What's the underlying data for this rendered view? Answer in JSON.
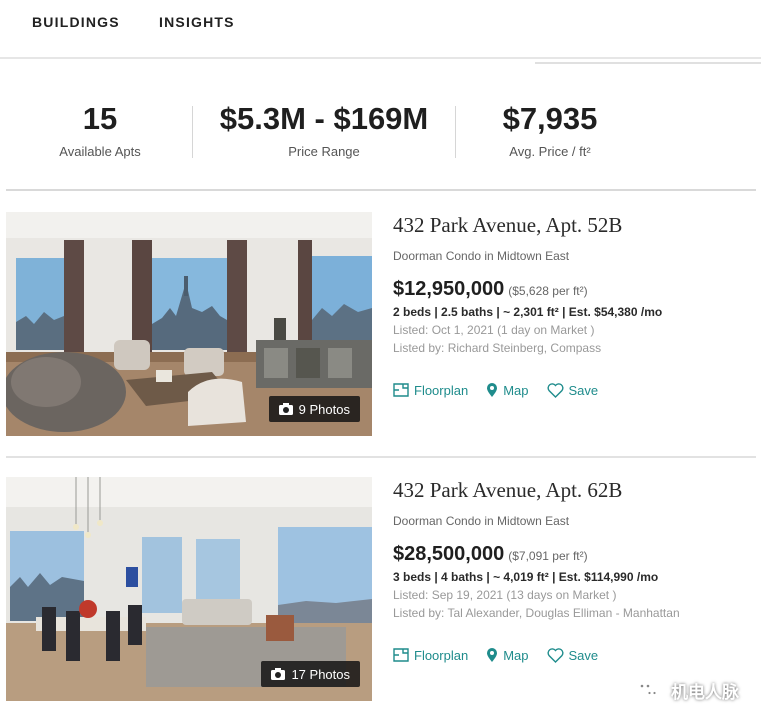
{
  "nav": {
    "buildings": "BUILDINGS",
    "insights": "INSIGHTS"
  },
  "stats": [
    {
      "value": "15",
      "label": "Available Apts"
    },
    {
      "value": "$5.3M - $169M",
      "label": "Price Range"
    },
    {
      "value": "$7,935",
      "label": "Avg. Price / ft²"
    }
  ],
  "listings": [
    {
      "address": "432 Park Avenue, Apt. 52B",
      "type": "Doorman Condo in Midtown East",
      "price": "$12,950,000",
      "price_per_sqft": "($5,628 per ft²)",
      "details": "2 beds | 2.5 baths | ~ 2,301 ft² | Est. $54,380 /mo",
      "listed": "Listed: Oct 1, 2021 (1 day on Market )",
      "listed_by": "Listed by: Richard Steinberg, Compass",
      "photos": "9 Photos"
    },
    {
      "address": "432 Park Avenue, Apt. 62B",
      "type": "Doorman Condo in Midtown East",
      "price": "$28,500,000",
      "price_per_sqft": "($7,091 per ft²)",
      "details": "3 beds | 4 baths | ~ 4,019 ft² | Est. $114,990 /mo",
      "listed": "Listed: Sep 19, 2021 (13 days on Market )",
      "listed_by": "Listed by: Tal Alexander, Douglas Elliman - Manhattan",
      "photos": "17 Photos"
    }
  ],
  "actions": {
    "floorplan": "Floorplan",
    "map": "Map",
    "save": "Save"
  },
  "watermark": "机电人脉",
  "colors": {
    "accent": "#1f8c8c",
    "text": "#222222",
    "muted": "#999999"
  }
}
